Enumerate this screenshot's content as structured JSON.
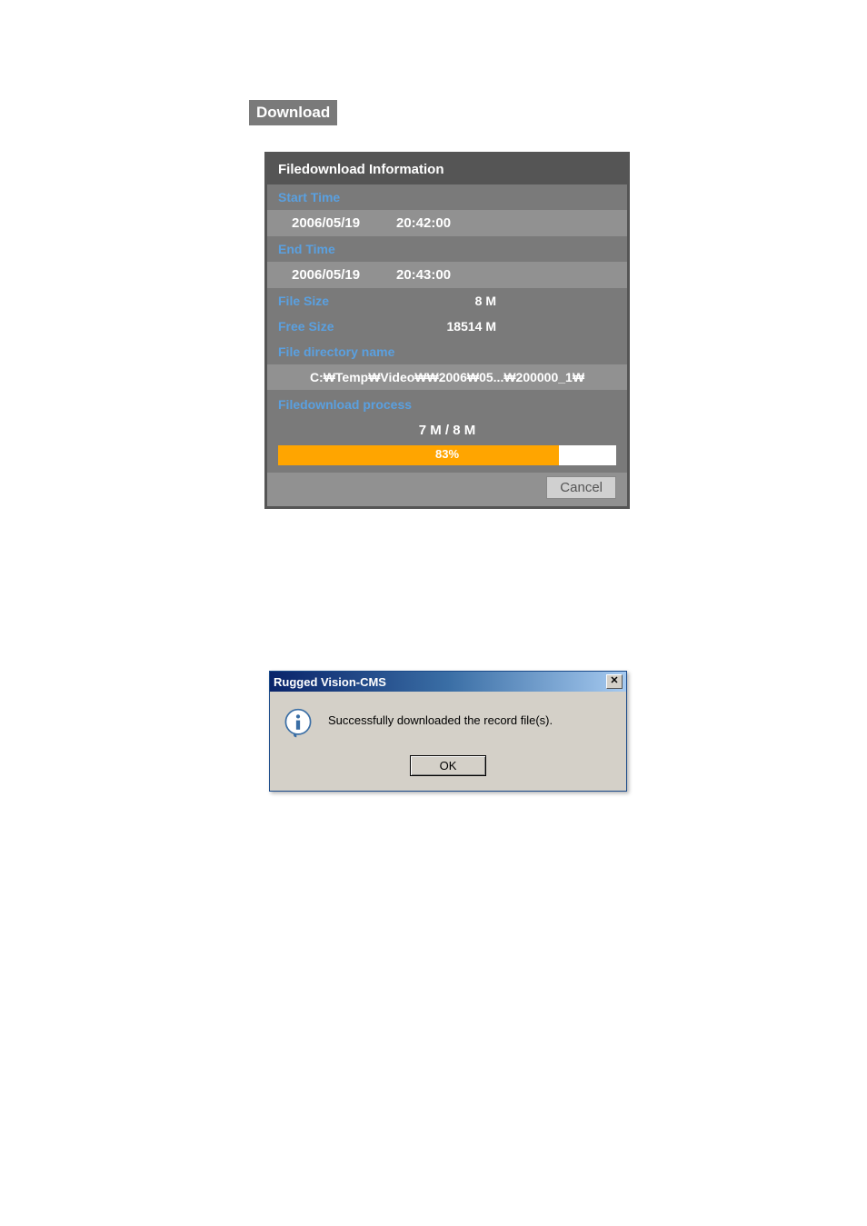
{
  "download_label": "Download",
  "panel": {
    "header": "Filedownload Information",
    "start_time_label": "Start Time",
    "start_date": "2006/05/19",
    "start_time": "20:42:00",
    "end_time_label": "End Time",
    "end_date": "2006/05/19",
    "end_time": "20:43:00",
    "file_size_label": "File Size",
    "file_size_value": "8 M",
    "free_size_label": "Free Size",
    "free_size_value": "18514 M",
    "dirname_label": "File directory name",
    "dirname_value": "C:₩Temp₩Video₩₩2006₩05...₩200000_1₩",
    "process_label": "Filedownload process",
    "progress_text": "7 M / 8 M",
    "progress_percent": "83%",
    "cancel_label": "Cancel"
  },
  "msgbox": {
    "title": "Rugged Vision-CMS",
    "close_glyph": "✕",
    "message": "Successfully downloaded the record file(s).",
    "ok_label": "OK"
  }
}
